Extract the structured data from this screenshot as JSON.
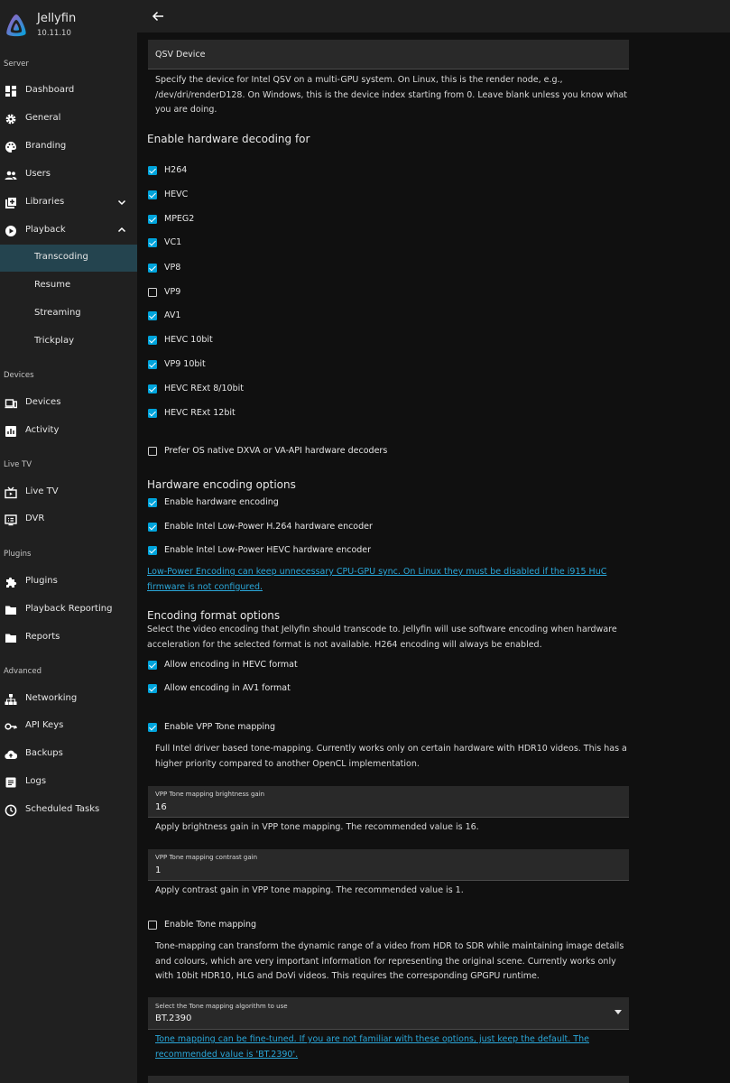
{
  "app": {
    "name": "Jellyfin",
    "version": "10.11.10",
    "accent": "#00a4dc"
  },
  "sidebar": {
    "sections": {
      "server": "Server",
      "devices": "Devices",
      "livetv": "Live TV",
      "plugins": "Plugins",
      "advanced": "Advanced"
    },
    "items": {
      "dashboard": "Dashboard",
      "general": "General",
      "branding": "Branding",
      "users": "Users",
      "libraries": "Libraries",
      "playback": "Playback",
      "transcoding": "Transcoding",
      "resume": "Resume",
      "streaming": "Streaming",
      "trickplay": "Trickplay",
      "devices": "Devices",
      "activity": "Activity",
      "livetv": "Live TV",
      "dvr": "DVR",
      "plugins": "Plugins",
      "playback_reporting": "Playback Reporting",
      "reports": "Reports",
      "networking": "Networking",
      "api_keys": "API Keys",
      "backups": "Backups",
      "logs": "Logs",
      "scheduled_tasks": "Scheduled Tasks"
    }
  },
  "qsv": {
    "label": "QSV Device",
    "value": "",
    "help": "Specify the device for Intel QSV on a multi-GPU system. On Linux, this is the render node, e.g., /dev/dri/renderD128. On Windows, this is the device index starting from 0. Leave blank unless you know what you are doing."
  },
  "decoding": {
    "title": "Enable hardware decoding for",
    "codecs": [
      {
        "label": "H264",
        "checked": true
      },
      {
        "label": "HEVC",
        "checked": true
      },
      {
        "label": "MPEG2",
        "checked": true
      },
      {
        "label": "VC1",
        "checked": true
      },
      {
        "label": "VP8",
        "checked": true
      },
      {
        "label": "VP9",
        "checked": false
      },
      {
        "label": "AV1",
        "checked": true
      },
      {
        "label": "HEVC 10bit",
        "checked": true
      },
      {
        "label": "VP9 10bit",
        "checked": true
      },
      {
        "label": "HEVC RExt 8/10bit",
        "checked": true
      },
      {
        "label": "HEVC RExt 12bit",
        "checked": true
      }
    ],
    "prefer_native": {
      "label": "Prefer OS native DXVA or VA-API hardware decoders",
      "checked": false
    }
  },
  "encoding": {
    "title": "Hardware encoding options",
    "enable_hw": {
      "label": "Enable hardware encoding",
      "checked": true
    },
    "lp_h264": {
      "label": "Enable Intel Low-Power H.264 hardware encoder",
      "checked": true
    },
    "lp_hevc": {
      "label": "Enable Intel Low-Power HEVC hardware encoder",
      "checked": true
    },
    "lp_link": "Low-Power Encoding can keep unnecessary CPU-GPU sync. On Linux they must be disabled if the i915 HuC firmware is not configured."
  },
  "format": {
    "title": "Encoding format options",
    "help": "Select the video encoding that Jellyfin should transcode to. Jellyfin will use software encoding when hardware acceleration for the selected format is not available. H264 encoding will always be enabled.",
    "hevc": {
      "label": "Allow encoding in HEVC format",
      "checked": true
    },
    "av1": {
      "label": "Allow encoding in AV1 format",
      "checked": true
    }
  },
  "vpp": {
    "enable": {
      "label": "Enable VPP Tone mapping",
      "checked": true
    },
    "help": "Full Intel driver based tone-mapping. Currently works only on certain hardware with HDR10 videos. This has a higher priority compared to another OpenCL implementation.",
    "brightness": {
      "label": "VPP Tone mapping brightness gain",
      "value": "16",
      "help": "Apply brightness gain in VPP tone mapping. The recommended value is 16."
    },
    "contrast": {
      "label": "VPP Tone mapping contrast gain",
      "value": "1",
      "help": "Apply contrast gain in VPP tone mapping. The recommended value is 1."
    }
  },
  "tonemap": {
    "enable": {
      "label": "Enable Tone mapping",
      "checked": false
    },
    "help": "Tone-mapping can transform the dynamic range of a video from HDR to SDR while maintaining image details and colours, which are very important information for representing the original scene. Currently works only with 10bit HDR10, HLG and DoVi videos. This requires the corresponding GPGPU runtime.",
    "algorithm": {
      "label": "Select the Tone mapping algorithm to use",
      "value": "BT.2390"
    },
    "link": "Tone mapping can be fine-tuned. If you are not familiar with these options, just keep the default. The recommended value is 'BT.2390'."
  }
}
